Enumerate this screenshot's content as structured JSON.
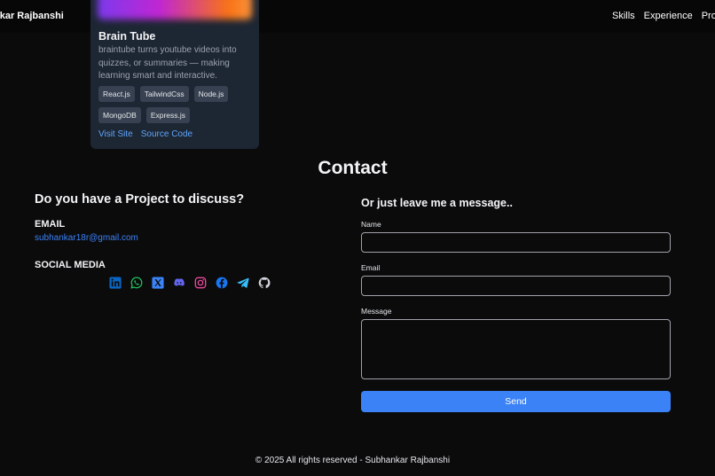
{
  "nav": {
    "brand": "nkar Rajbanshi",
    "links": [
      "Skills",
      "Experience",
      "Projec"
    ]
  },
  "project_card": {
    "title": "Brain Tube",
    "description": "braintube turns youtube videos into quizzes, or summaries — making learning smart and interactive.",
    "tags": [
      "React.js",
      "TailwindCss",
      "Node.js",
      "MongoDB",
      "Express.js"
    ],
    "visit_label": "Visit Site",
    "source_label": "Source Code"
  },
  "contact": {
    "title": "Contact",
    "left": {
      "heading": "Do you have a Project to discuss?",
      "email_label": "EMAIL",
      "email_value": "subhankar18r@gmail.com",
      "social_label": "SOCIAL MEDIA",
      "social_icons": [
        "linkedin-icon",
        "whatsapp-icon",
        "x-icon",
        "discord-icon",
        "instagram-icon",
        "facebook-icon",
        "telegram-icon",
        "github-icon"
      ]
    },
    "form": {
      "heading": "Or just leave me a message..",
      "name_label": "Name",
      "email_label": "Email",
      "message_label": "Message",
      "send_label": "Send"
    }
  },
  "colors": {
    "accent": "#3b82f6",
    "linkedin": "#0a66c2",
    "whatsapp": "#22c55e",
    "x": "#3b82f6",
    "discord": "#6366f1",
    "instagram": "#ec4899",
    "facebook": "#1877f2",
    "telegram": "#38bdf8",
    "github": "#d1d5db"
  },
  "footer": {
    "text": "© 2025 All rights reserved - Subhankar Rajbanshi"
  }
}
